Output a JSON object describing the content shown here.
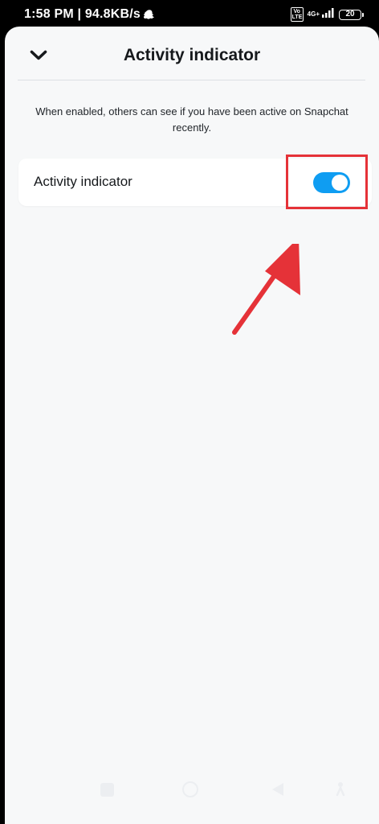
{
  "status_bar": {
    "time_speed": "1:58 PM | 94.8KB/s",
    "volte": "Vo LTE",
    "network": "4G+",
    "battery": "20"
  },
  "header": {
    "title": "Activity indicator"
  },
  "description": "When enabled, others can see if you have been active on Snapchat recently.",
  "setting": {
    "label": "Activity indicator",
    "enabled": true
  },
  "colors": {
    "toggle_on": "#0f9df2",
    "highlight": "#e53238",
    "background": "#f7f8f9"
  }
}
